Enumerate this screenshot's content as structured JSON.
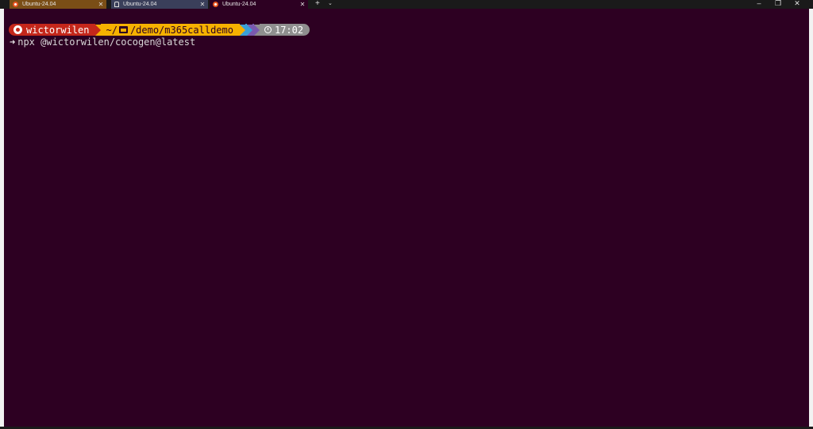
{
  "tabs": [
    {
      "label": "Ubuntu-24.04",
      "close": "✕"
    },
    {
      "label": "Ubuntu-24.04",
      "close": "✕"
    },
    {
      "label": "Ubuntu-24.04",
      "close": "✕"
    }
  ],
  "tab_controls": {
    "new_tab": "+",
    "dropdown": "⌄"
  },
  "window_controls": {
    "minimize": "–",
    "maximize": "❐",
    "close": "✕"
  },
  "prompt": {
    "user": "wictorwilen",
    "path_prefix": "~/",
    "path": "/demo/m365calldemo",
    "time": "17:02"
  },
  "command": {
    "arrow": "➜",
    "text": "npx @wictorwilen/cocogen@latest"
  },
  "colors": {
    "background": "#2d0022",
    "user_segment": "#c4271b",
    "path_segment": "#f6b100",
    "time_segment": "#8f8f8f"
  }
}
